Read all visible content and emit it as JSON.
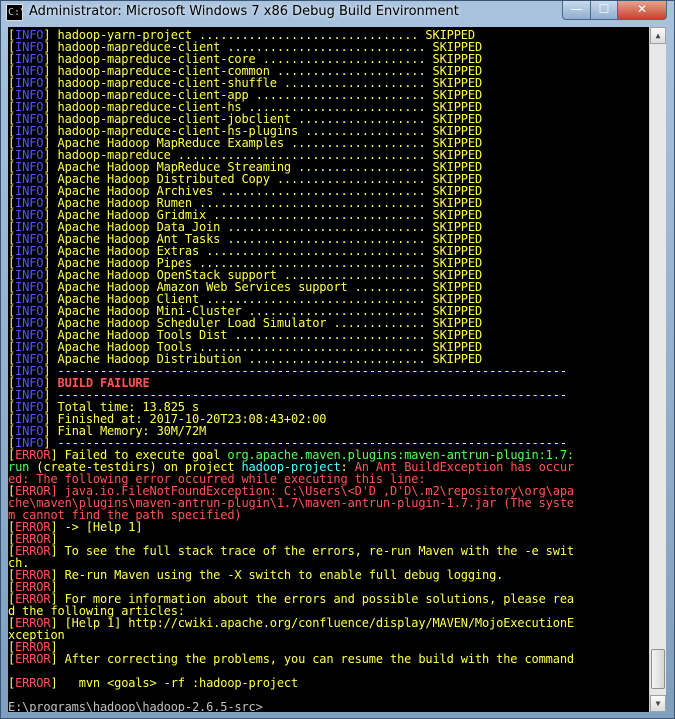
{
  "window": {
    "title": "Administrator:  Microsoft Windows 7 x86 Debug Build Environment",
    "icon_text": "C:\\",
    "min_glyph": "—",
    "max_glyph": "☐",
    "close_glyph": "✕"
  },
  "scrollbar": {
    "up_glyph": "▲",
    "down_glyph": "▼",
    "position_fraction": 0.99
  },
  "colors": {
    "console_bg": "#000000",
    "info_tag": "#5555ff",
    "text_yellow": "#ffff54",
    "error_red": "#ff5555",
    "goal_green": "#55ff55",
    "project_cyan": "#55ffff"
  },
  "console": {
    "lines": [
      [
        {
          "t": "[",
          "c": "yellow"
        },
        {
          "t": "INFO",
          "c": "blue"
        },
        {
          "t": "] hadoop-yarn-project ............................... SKIPPED",
          "c": "yellow"
        }
      ],
      [
        {
          "t": "[",
          "c": "yellow"
        },
        {
          "t": "INFO",
          "c": "blue"
        },
        {
          "t": "] hadoop-mapreduce-client ............................ SKIPPED",
          "c": "yellow"
        }
      ],
      [
        {
          "t": "[",
          "c": "yellow"
        },
        {
          "t": "INFO",
          "c": "blue"
        },
        {
          "t": "] hadoop-mapreduce-client-core ....................... SKIPPED",
          "c": "yellow"
        }
      ],
      [
        {
          "t": "[",
          "c": "yellow"
        },
        {
          "t": "INFO",
          "c": "blue"
        },
        {
          "t": "] hadoop-mapreduce-client-common ..................... SKIPPED",
          "c": "yellow"
        }
      ],
      [
        {
          "t": "[",
          "c": "yellow"
        },
        {
          "t": "INFO",
          "c": "blue"
        },
        {
          "t": "] hadoop-mapreduce-client-shuffle .................... SKIPPED",
          "c": "yellow"
        }
      ],
      [
        {
          "t": "[",
          "c": "yellow"
        },
        {
          "t": "INFO",
          "c": "blue"
        },
        {
          "t": "] hadoop-mapreduce-client-app ........................ SKIPPED",
          "c": "yellow"
        }
      ],
      [
        {
          "t": "[",
          "c": "yellow"
        },
        {
          "t": "INFO",
          "c": "blue"
        },
        {
          "t": "] hadoop-mapreduce-client-hs ......................... SKIPPED",
          "c": "yellow"
        }
      ],
      [
        {
          "t": "[",
          "c": "yellow"
        },
        {
          "t": "INFO",
          "c": "blue"
        },
        {
          "t": "] hadoop-mapreduce-client-jobclient .................. SKIPPED",
          "c": "yellow"
        }
      ],
      [
        {
          "t": "[",
          "c": "yellow"
        },
        {
          "t": "INFO",
          "c": "blue"
        },
        {
          "t": "] hadoop-mapreduce-client-hs-plugins ................. SKIPPED",
          "c": "yellow"
        }
      ],
      [
        {
          "t": "[",
          "c": "yellow"
        },
        {
          "t": "INFO",
          "c": "blue"
        },
        {
          "t": "] Apache Hadoop MapReduce Examples ................... SKIPPED",
          "c": "yellow"
        }
      ],
      [
        {
          "t": "[",
          "c": "yellow"
        },
        {
          "t": "INFO",
          "c": "blue"
        },
        {
          "t": "] hadoop-mapreduce ................................... SKIPPED",
          "c": "yellow"
        }
      ],
      [
        {
          "t": "[",
          "c": "yellow"
        },
        {
          "t": "INFO",
          "c": "blue"
        },
        {
          "t": "] Apache Hadoop MapReduce Streaming .................. SKIPPED",
          "c": "yellow"
        }
      ],
      [
        {
          "t": "[",
          "c": "yellow"
        },
        {
          "t": "INFO",
          "c": "blue"
        },
        {
          "t": "] Apache Hadoop Distributed Copy ..................... SKIPPED",
          "c": "yellow"
        }
      ],
      [
        {
          "t": "[",
          "c": "yellow"
        },
        {
          "t": "INFO",
          "c": "blue"
        },
        {
          "t": "] Apache Hadoop Archives ............................. SKIPPED",
          "c": "yellow"
        }
      ],
      [
        {
          "t": "[",
          "c": "yellow"
        },
        {
          "t": "INFO",
          "c": "blue"
        },
        {
          "t": "] Apache Hadoop Rumen ................................ SKIPPED",
          "c": "yellow"
        }
      ],
      [
        {
          "t": "[",
          "c": "yellow"
        },
        {
          "t": "INFO",
          "c": "blue"
        },
        {
          "t": "] Apache Hadoop Gridmix .............................. SKIPPED",
          "c": "yellow"
        }
      ],
      [
        {
          "t": "[",
          "c": "yellow"
        },
        {
          "t": "INFO",
          "c": "blue"
        },
        {
          "t": "] Apache Hadoop Data Join ............................ SKIPPED",
          "c": "yellow"
        }
      ],
      [
        {
          "t": "[",
          "c": "yellow"
        },
        {
          "t": "INFO",
          "c": "blue"
        },
        {
          "t": "] Apache Hadoop Ant Tasks ............................ SKIPPED",
          "c": "yellow"
        }
      ],
      [
        {
          "t": "[",
          "c": "yellow"
        },
        {
          "t": "INFO",
          "c": "blue"
        },
        {
          "t": "] Apache Hadoop Extras ............................... SKIPPED",
          "c": "yellow"
        }
      ],
      [
        {
          "t": "[",
          "c": "yellow"
        },
        {
          "t": "INFO",
          "c": "blue"
        },
        {
          "t": "] Apache Hadoop Pipes ................................ SKIPPED",
          "c": "yellow"
        }
      ],
      [
        {
          "t": "[",
          "c": "yellow"
        },
        {
          "t": "INFO",
          "c": "blue"
        },
        {
          "t": "] Apache Hadoop OpenStack support .................... SKIPPED",
          "c": "yellow"
        }
      ],
      [
        {
          "t": "[",
          "c": "yellow"
        },
        {
          "t": "INFO",
          "c": "blue"
        },
        {
          "t": "] Apache Hadoop Amazon Web Services support .......... SKIPPED",
          "c": "yellow"
        }
      ],
      [
        {
          "t": "[",
          "c": "yellow"
        },
        {
          "t": "INFO",
          "c": "blue"
        },
        {
          "t": "] Apache Hadoop Client ............................... SKIPPED",
          "c": "yellow"
        }
      ],
      [
        {
          "t": "[",
          "c": "yellow"
        },
        {
          "t": "INFO",
          "c": "blue"
        },
        {
          "t": "] Apache Hadoop Mini-Cluster ......................... SKIPPED",
          "c": "yellow"
        }
      ],
      [
        {
          "t": "[",
          "c": "yellow"
        },
        {
          "t": "INFO",
          "c": "blue"
        },
        {
          "t": "] Apache Hadoop Scheduler Load Simulator ............. SKIPPED",
          "c": "yellow"
        }
      ],
      [
        {
          "t": "[",
          "c": "yellow"
        },
        {
          "t": "INFO",
          "c": "blue"
        },
        {
          "t": "] Apache Hadoop Tools Dist ........................... SKIPPED",
          "c": "yellow"
        }
      ],
      [
        {
          "t": "[",
          "c": "yellow"
        },
        {
          "t": "INFO",
          "c": "blue"
        },
        {
          "t": "] Apache Hadoop Tools ................................ SKIPPED",
          "c": "yellow"
        }
      ],
      [
        {
          "t": "[",
          "c": "yellow"
        },
        {
          "t": "INFO",
          "c": "blue"
        },
        {
          "t": "] Apache Hadoop Distribution ......................... SKIPPED",
          "c": "yellow"
        }
      ],
      [
        {
          "t": "[",
          "c": "yellow"
        },
        {
          "t": "INFO",
          "c": "blue"
        },
        {
          "t": "] ------------------------------------------------------------------------",
          "c": "yellow"
        }
      ],
      [
        {
          "t": "[",
          "c": "yellow"
        },
        {
          "t": "INFO",
          "c": "blue"
        },
        {
          "t": "] ",
          "c": "yellow"
        },
        {
          "t": "BUILD FAILURE",
          "c": "red",
          "b": true
        }
      ],
      [
        {
          "t": "[",
          "c": "yellow"
        },
        {
          "t": "INFO",
          "c": "blue"
        },
        {
          "t": "] ------------------------------------------------------------------------",
          "c": "yellow"
        }
      ],
      [
        {
          "t": "[",
          "c": "yellow"
        },
        {
          "t": "INFO",
          "c": "blue"
        },
        {
          "t": "] Total time: 13.825 s",
          "c": "yellow"
        }
      ],
      [
        {
          "t": "[",
          "c": "yellow"
        },
        {
          "t": "INFO",
          "c": "blue"
        },
        {
          "t": "] Finished at: 2017-10-20T23:08:43+02:00",
          "c": "yellow"
        }
      ],
      [
        {
          "t": "[",
          "c": "yellow"
        },
        {
          "t": "INFO",
          "c": "blue"
        },
        {
          "t": "] Final Memory: 30M/72M",
          "c": "yellow"
        }
      ],
      [
        {
          "t": "[",
          "c": "yellow"
        },
        {
          "t": "INFO",
          "c": "blue"
        },
        {
          "t": "] ------------------------------------------------------------------------",
          "c": "yellow"
        }
      ],
      [
        {
          "t": "[",
          "c": "yellow"
        },
        {
          "t": "ERROR",
          "c": "red"
        },
        {
          "t": "] Failed to execute goal ",
          "c": "yellow"
        },
        {
          "t": "org.apache.maven.plugins:maven-antrun-plugin:1.7:",
          "c": "green"
        }
      ],
      [
        {
          "t": "run",
          "c": "green"
        },
        {
          "t": " (create-testdirs) on project ",
          "c": "yellow"
        },
        {
          "t": "hadoop-project",
          "c": "cyan"
        },
        {
          "t": ": ",
          "c": "yellow"
        },
        {
          "t": "An Ant BuildException has occur",
          "c": "red"
        }
      ],
      [
        {
          "t": "ed: The following error occurred while executing this line:",
          "c": "red"
        }
      ],
      [
        {
          "t": "[",
          "c": "yellow"
        },
        {
          "t": "ERROR",
          "c": "red"
        },
        {
          "t": "] java.io.FileNotFoundException: C:\\Users\\<D'D ,D'D\\.m2\\repository\\org\\apa",
          "c": "red"
        }
      ],
      [
        {
          "t": "che\\maven\\plugins\\maven-antrun-plugin\\1.7\\maven-antrun-plugin-1.7.jar (The syste",
          "c": "red"
        }
      ],
      [
        {
          "t": "m cannot find the path specified)",
          "c": "red"
        }
      ],
      [
        {
          "t": "[",
          "c": "yellow"
        },
        {
          "t": "ERROR",
          "c": "red"
        },
        {
          "t": "] -> [Help 1]",
          "c": "yellow"
        }
      ],
      [
        {
          "t": "[",
          "c": "yellow"
        },
        {
          "t": "ERROR",
          "c": "red"
        },
        {
          "t": "]",
          "c": "yellow"
        }
      ],
      [
        {
          "t": "[",
          "c": "yellow"
        },
        {
          "t": "ERROR",
          "c": "red"
        },
        {
          "t": "] To see the full stack trace of the errors, re-run Maven with the -e swit",
          "c": "yellow"
        }
      ],
      [
        {
          "t": "ch.",
          "c": "yellow"
        }
      ],
      [
        {
          "t": "[",
          "c": "yellow"
        },
        {
          "t": "ERROR",
          "c": "red"
        },
        {
          "t": "] Re-run Maven using the -X switch to enable full debug logging.",
          "c": "yellow"
        }
      ],
      [
        {
          "t": "[",
          "c": "yellow"
        },
        {
          "t": "ERROR",
          "c": "red"
        },
        {
          "t": "]",
          "c": "yellow"
        }
      ],
      [
        {
          "t": "[",
          "c": "yellow"
        },
        {
          "t": "ERROR",
          "c": "red"
        },
        {
          "t": "] For more information about the errors and possible solutions, please rea",
          "c": "yellow"
        }
      ],
      [
        {
          "t": "d the following articles:",
          "c": "yellow"
        }
      ],
      [
        {
          "t": "[",
          "c": "yellow"
        },
        {
          "t": "ERROR",
          "c": "red"
        },
        {
          "t": "] [Help 1] http://cwiki.apache.org/confluence/display/MAVEN/MojoExecutionE",
          "c": "yellow"
        }
      ],
      [
        {
          "t": "xception",
          "c": "yellow"
        }
      ],
      [
        {
          "t": "[",
          "c": "yellow"
        },
        {
          "t": "ERROR",
          "c": "red"
        },
        {
          "t": "]",
          "c": "yellow"
        }
      ],
      [
        {
          "t": "[",
          "c": "yellow"
        },
        {
          "t": "ERROR",
          "c": "red"
        },
        {
          "t": "] After correcting the problems, you can resume the build with the command",
          "c": "yellow"
        }
      ],
      [],
      [
        {
          "t": "[",
          "c": "yellow"
        },
        {
          "t": "ERROR",
          "c": "red"
        },
        {
          "t": "]   mvn <goals> -rf :hadoop-project",
          "c": "yellow"
        }
      ],
      [],
      [
        {
          "t": "E:\\programs\\hadoop\\hadoop-2.6.5-src>",
          "c": "white"
        }
      ]
    ]
  }
}
